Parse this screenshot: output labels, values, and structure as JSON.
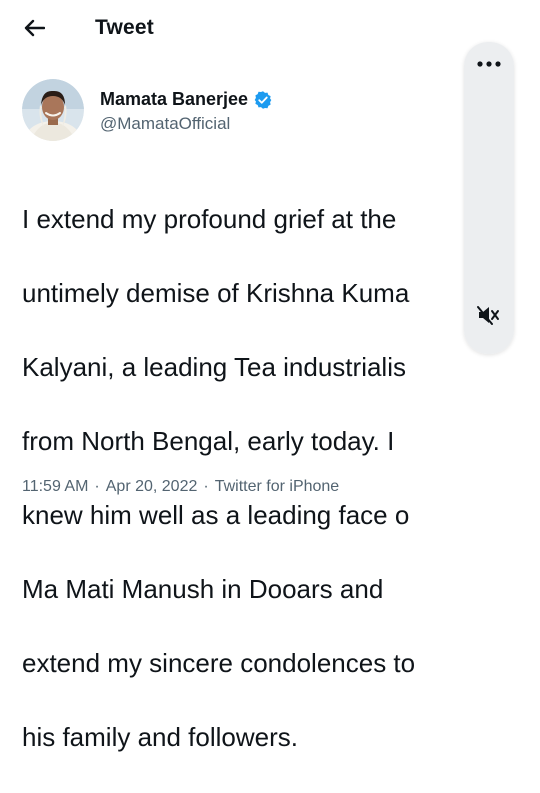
{
  "header": {
    "title": "Tweet",
    "back_icon": "arrow-left-icon"
  },
  "author": {
    "display_name": "Mamata Banerjee",
    "handle": "@MamataOfficial",
    "verified": true,
    "verified_color": "#1d9bf0",
    "avatar_icon": "profile-photo"
  },
  "tweet": {
    "text_lines": [
      "I extend my profound grief at the",
      "untimely demise of Krishna Kuma",
      "Kalyani, a leading Tea industrialis",
      "from North Bengal, early today. I",
      "knew him well as a leading face o",
      "Ma Mati Manush in Dooars and",
      "extend my sincere condolences to",
      "his family and followers."
    ]
  },
  "meta": {
    "time": "11:59 AM",
    "separator": "·",
    "date": "Apr 20, 2022",
    "source": "Twitter for iPhone"
  },
  "side_panel": {
    "more_icon": "more-vertical-icon",
    "mute_icon": "speaker-muted-icon"
  },
  "colors": {
    "text_primary": "#0f1419",
    "text_secondary": "#536471",
    "panel_bg": "#ebedef"
  }
}
